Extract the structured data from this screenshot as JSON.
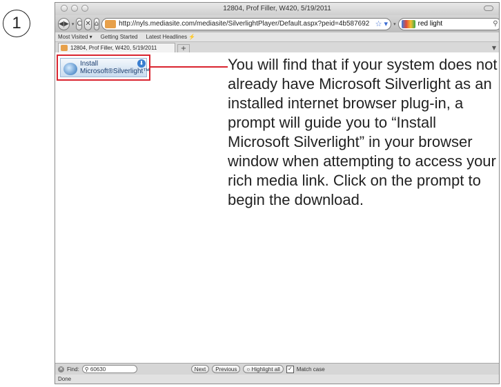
{
  "step": {
    "number": "1"
  },
  "window": {
    "title": "12804, Prof Filler, W420, 5/19/2011"
  },
  "toolbar": {
    "back_icon": "back-arrow",
    "forward_icon": "forward-arrow",
    "reload": "C",
    "stop": "✕",
    "home": "⌂",
    "url": "http://nyls.mediasite.com/mediasite/SilverlightPlayer/Default.aspx?peid=4b587692",
    "search_value": "red light"
  },
  "bookmarks": {
    "items": [
      "Most Visited ▾",
      "Getting Started",
      "Latest Headlines ⚡"
    ]
  },
  "tabs": [
    {
      "label": "12804, Prof Filler, W420, 5/19/2011"
    }
  ],
  "new_tab": "+",
  "silverlight": {
    "line1": "Install",
    "line2": "Microsoft®Silverlight™"
  },
  "instruction": "You will find that if your system does not already have Microsoft Silverlight as an installed internet browser plug-in, a prompt will guide you to “Install Microsoft Silverlight” in your browser window when attempting to access your rich media link. Click on the prompt to begin the download.",
  "findbar": {
    "label": "Find:",
    "value": "60630",
    "next": "Next",
    "previous": "Previous",
    "highlight": "Highlight all",
    "match_case": "Match case"
  },
  "status": {
    "text": "Done"
  },
  "colors": {
    "accent_red": "#d9232e"
  }
}
